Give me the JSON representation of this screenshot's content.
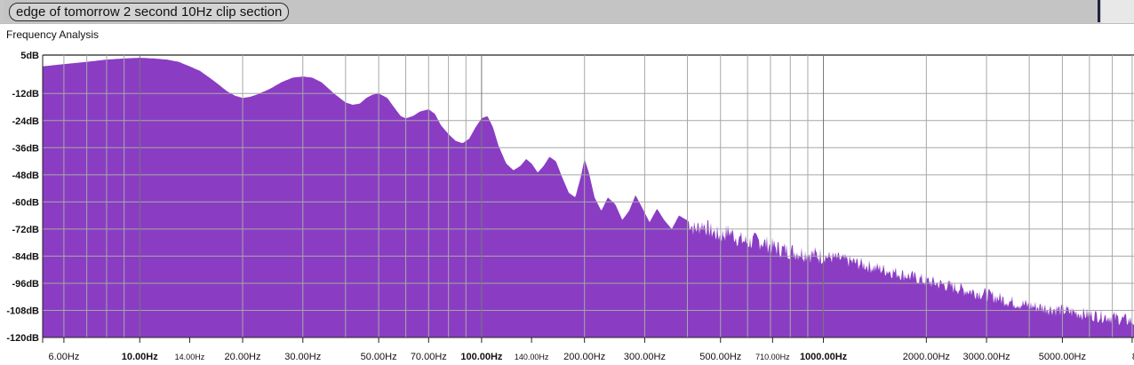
{
  "window": {
    "title": "edge of tomorrow 2 second 10Hz clip section"
  },
  "panel": {
    "label": "Frequency Analysis"
  },
  "chart_data": {
    "type": "area",
    "xscale": "log",
    "xlim_hz": [
      5.2,
      8100
    ],
    "ylim_db": [
      -120,
      5
    ],
    "y_ticks": [
      {
        "v": 5,
        "label": "5dB"
      },
      {
        "v": -12,
        "label": "-12dB"
      },
      {
        "v": -24,
        "label": "-24dB"
      },
      {
        "v": -36,
        "label": "-36dB"
      },
      {
        "v": -48,
        "label": "-48dB"
      },
      {
        "v": -60,
        "label": "-60dB"
      },
      {
        "v": -72,
        "label": "-72dB"
      },
      {
        "v": -84,
        "label": "-84dB"
      },
      {
        "v": -96,
        "label": "-96dB"
      },
      {
        "v": -108,
        "label": "-108dB"
      },
      {
        "v": -120,
        "label": "-120dB"
      }
    ],
    "x_ticks": [
      {
        "v": 6,
        "label": "6.00Hz",
        "style": "normal"
      },
      {
        "v": 10,
        "label": "10.00Hz",
        "style": "major"
      },
      {
        "v": 14,
        "label": "14.00Hz",
        "style": "small"
      },
      {
        "v": 20,
        "label": "20.00Hz",
        "style": "normal"
      },
      {
        "v": 30,
        "label": "30.00Hz",
        "style": "normal"
      },
      {
        "v": 50,
        "label": "50.00Hz",
        "style": "normal"
      },
      {
        "v": 70,
        "label": "70.00Hz",
        "style": "normal"
      },
      {
        "v": 100,
        "label": "100.00Hz",
        "style": "major"
      },
      {
        "v": 140,
        "label": "140.00Hz",
        "style": "small"
      },
      {
        "v": 200,
        "label": "200.00Hz",
        "style": "normal"
      },
      {
        "v": 300,
        "label": "300.00Hz",
        "style": "normal"
      },
      {
        "v": 500,
        "label": "500.00Hz",
        "style": "normal"
      },
      {
        "v": 710,
        "label": "710.00Hz",
        "style": "small"
      },
      {
        "v": 1000,
        "label": "1000.00Hz",
        "style": "major"
      },
      {
        "v": 2000,
        "label": "2000.00Hz",
        "style": "normal"
      },
      {
        "v": 3000,
        "label": "3000.00Hz",
        "style": "normal"
      },
      {
        "v": 5000,
        "label": "5000.00Hz",
        "style": "normal"
      },
      {
        "v": 8000,
        "label": "8",
        "style": "normal"
      }
    ],
    "grid": true,
    "series": [
      {
        "color": "#8a3dc3",
        "points": [
          [
            5.2,
            0
          ],
          [
            6,
            1
          ],
          [
            7,
            2
          ],
          [
            8,
            3
          ],
          [
            9,
            3.5
          ],
          [
            10,
            3.8
          ],
          [
            11,
            3.5
          ],
          [
            12,
            3
          ],
          [
            13,
            2
          ],
          [
            14,
            0
          ],
          [
            15,
            -2
          ],
          [
            16,
            -5
          ],
          [
            17,
            -8
          ],
          [
            18,
            -11
          ],
          [
            19,
            -13
          ],
          [
            20,
            -14
          ],
          [
            21,
            -13.5
          ],
          [
            22,
            -12.5
          ],
          [
            24,
            -10
          ],
          [
            26,
            -7
          ],
          [
            28,
            -5
          ],
          [
            30,
            -4.5
          ],
          [
            32,
            -5
          ],
          [
            34,
            -7
          ],
          [
            37,
            -12
          ],
          [
            40,
            -16
          ],
          [
            42,
            -17
          ],
          [
            44,
            -16.5
          ],
          [
            46,
            -14
          ],
          [
            48,
            -12.5
          ],
          [
            50,
            -12
          ],
          [
            53,
            -14
          ],
          [
            56,
            -19
          ],
          [
            58,
            -22
          ],
          [
            60,
            -23
          ],
          [
            63,
            -22
          ],
          [
            66,
            -20
          ],
          [
            70,
            -19
          ],
          [
            73,
            -21
          ],
          [
            76,
            -26
          ],
          [
            80,
            -30
          ],
          [
            84,
            -33
          ],
          [
            88,
            -34
          ],
          [
            92,
            -32
          ],
          [
            96,
            -27
          ],
          [
            100,
            -23
          ],
          [
            104,
            -22
          ],
          [
            108,
            -27
          ],
          [
            112,
            -35
          ],
          [
            118,
            -43
          ],
          [
            124,
            -46
          ],
          [
            130,
            -44
          ],
          [
            135,
            -41
          ],
          [
            140,
            -43
          ],
          [
            146,
            -47
          ],
          [
            152,
            -44
          ],
          [
            158,
            -40
          ],
          [
            165,
            -42
          ],
          [
            172,
            -49
          ],
          [
            180,
            -56
          ],
          [
            188,
            -58
          ],
          [
            195,
            -49
          ],
          [
            200,
            -41
          ],
          [
            206,
            -47
          ],
          [
            214,
            -58
          ],
          [
            224,
            -64
          ],
          [
            234,
            -58
          ],
          [
            246,
            -61
          ],
          [
            258,
            -68
          ],
          [
            270,
            -64
          ],
          [
            282,
            -57
          ],
          [
            296,
            -63
          ],
          [
            310,
            -69
          ],
          [
            326,
            -63
          ],
          [
            342,
            -68
          ],
          [
            360,
            -72
          ],
          [
            378,
            -66
          ],
          [
            398,
            -68
          ],
          [
            420,
            -72
          ],
          [
            444,
            -70
          ],
          [
            470,
            -73
          ],
          [
            500,
            -75
          ],
          [
            530,
            -73
          ],
          [
            560,
            -76
          ],
          [
            600,
            -78
          ],
          [
            640,
            -77
          ],
          [
            690,
            -79
          ],
          [
            750,
            -81
          ],
          [
            820,
            -82
          ],
          [
            900,
            -83
          ],
          [
            1000,
            -84
          ],
          [
            1100,
            -85
          ],
          [
            1250,
            -87
          ],
          [
            1400,
            -89
          ],
          [
            1600,
            -91
          ],
          [
            1800,
            -93
          ],
          [
            2000,
            -95
          ],
          [
            2300,
            -97
          ],
          [
            2600,
            -99
          ],
          [
            3000,
            -101
          ],
          [
            3500,
            -104
          ],
          [
            4000,
            -106
          ],
          [
            4500,
            -107
          ],
          [
            5000,
            -108
          ],
          [
            6000,
            -110
          ],
          [
            7000,
            -111
          ],
          [
            8100,
            -113
          ]
        ]
      }
    ]
  }
}
